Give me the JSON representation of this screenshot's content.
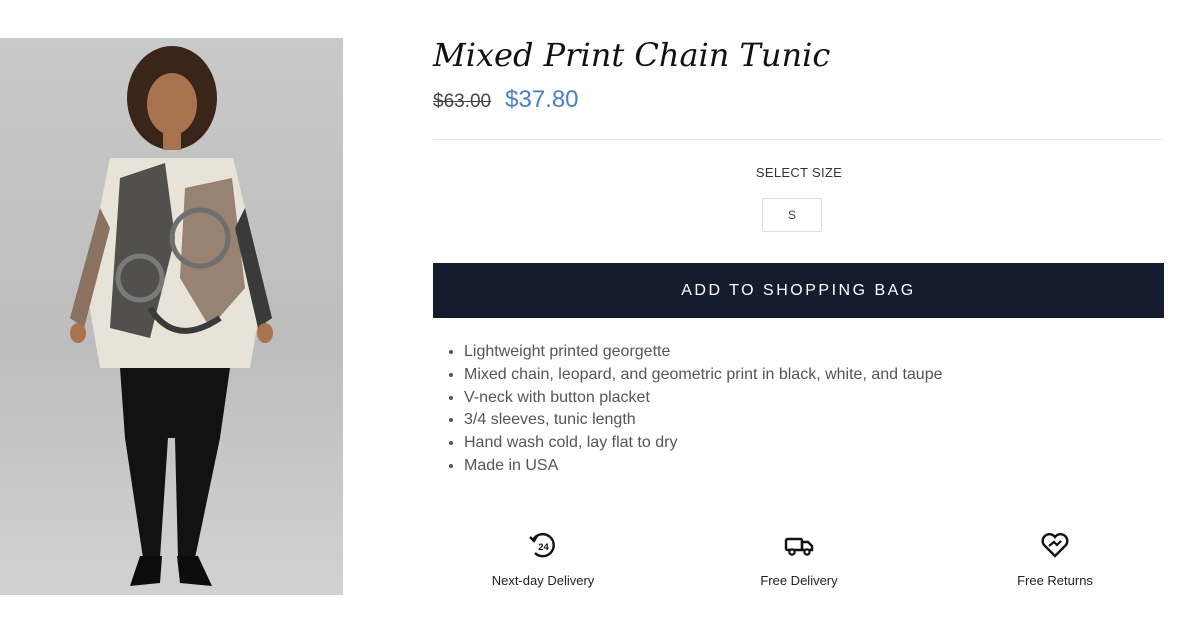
{
  "product": {
    "title": "Mixed Print Chain Tunic",
    "price_original": "$63.00",
    "price_sale": "$37.80",
    "price_sale_color": "#4a7fc2"
  },
  "size_selector": {
    "label": "SELECT SIZE",
    "options": [
      "S"
    ]
  },
  "cart": {
    "add_button_label": "ADD TO SHOPPING BAG",
    "button_color": "#141c2e"
  },
  "features": [
    "Lightweight printed georgette",
    "Mixed chain, leopard, and geometric print in black, white, and taupe",
    "V-neck with button placket",
    "3/4 sleeves, tunic length",
    "Hand wash cold, lay flat to dry",
    "Made in USA"
  ],
  "services": [
    {
      "icon": "24-hour-delivery-icon",
      "label": "Next-day Delivery"
    },
    {
      "icon": "truck-icon",
      "label": "Free Delivery"
    },
    {
      "icon": "heart-return-icon",
      "label": "Free Returns"
    }
  ]
}
